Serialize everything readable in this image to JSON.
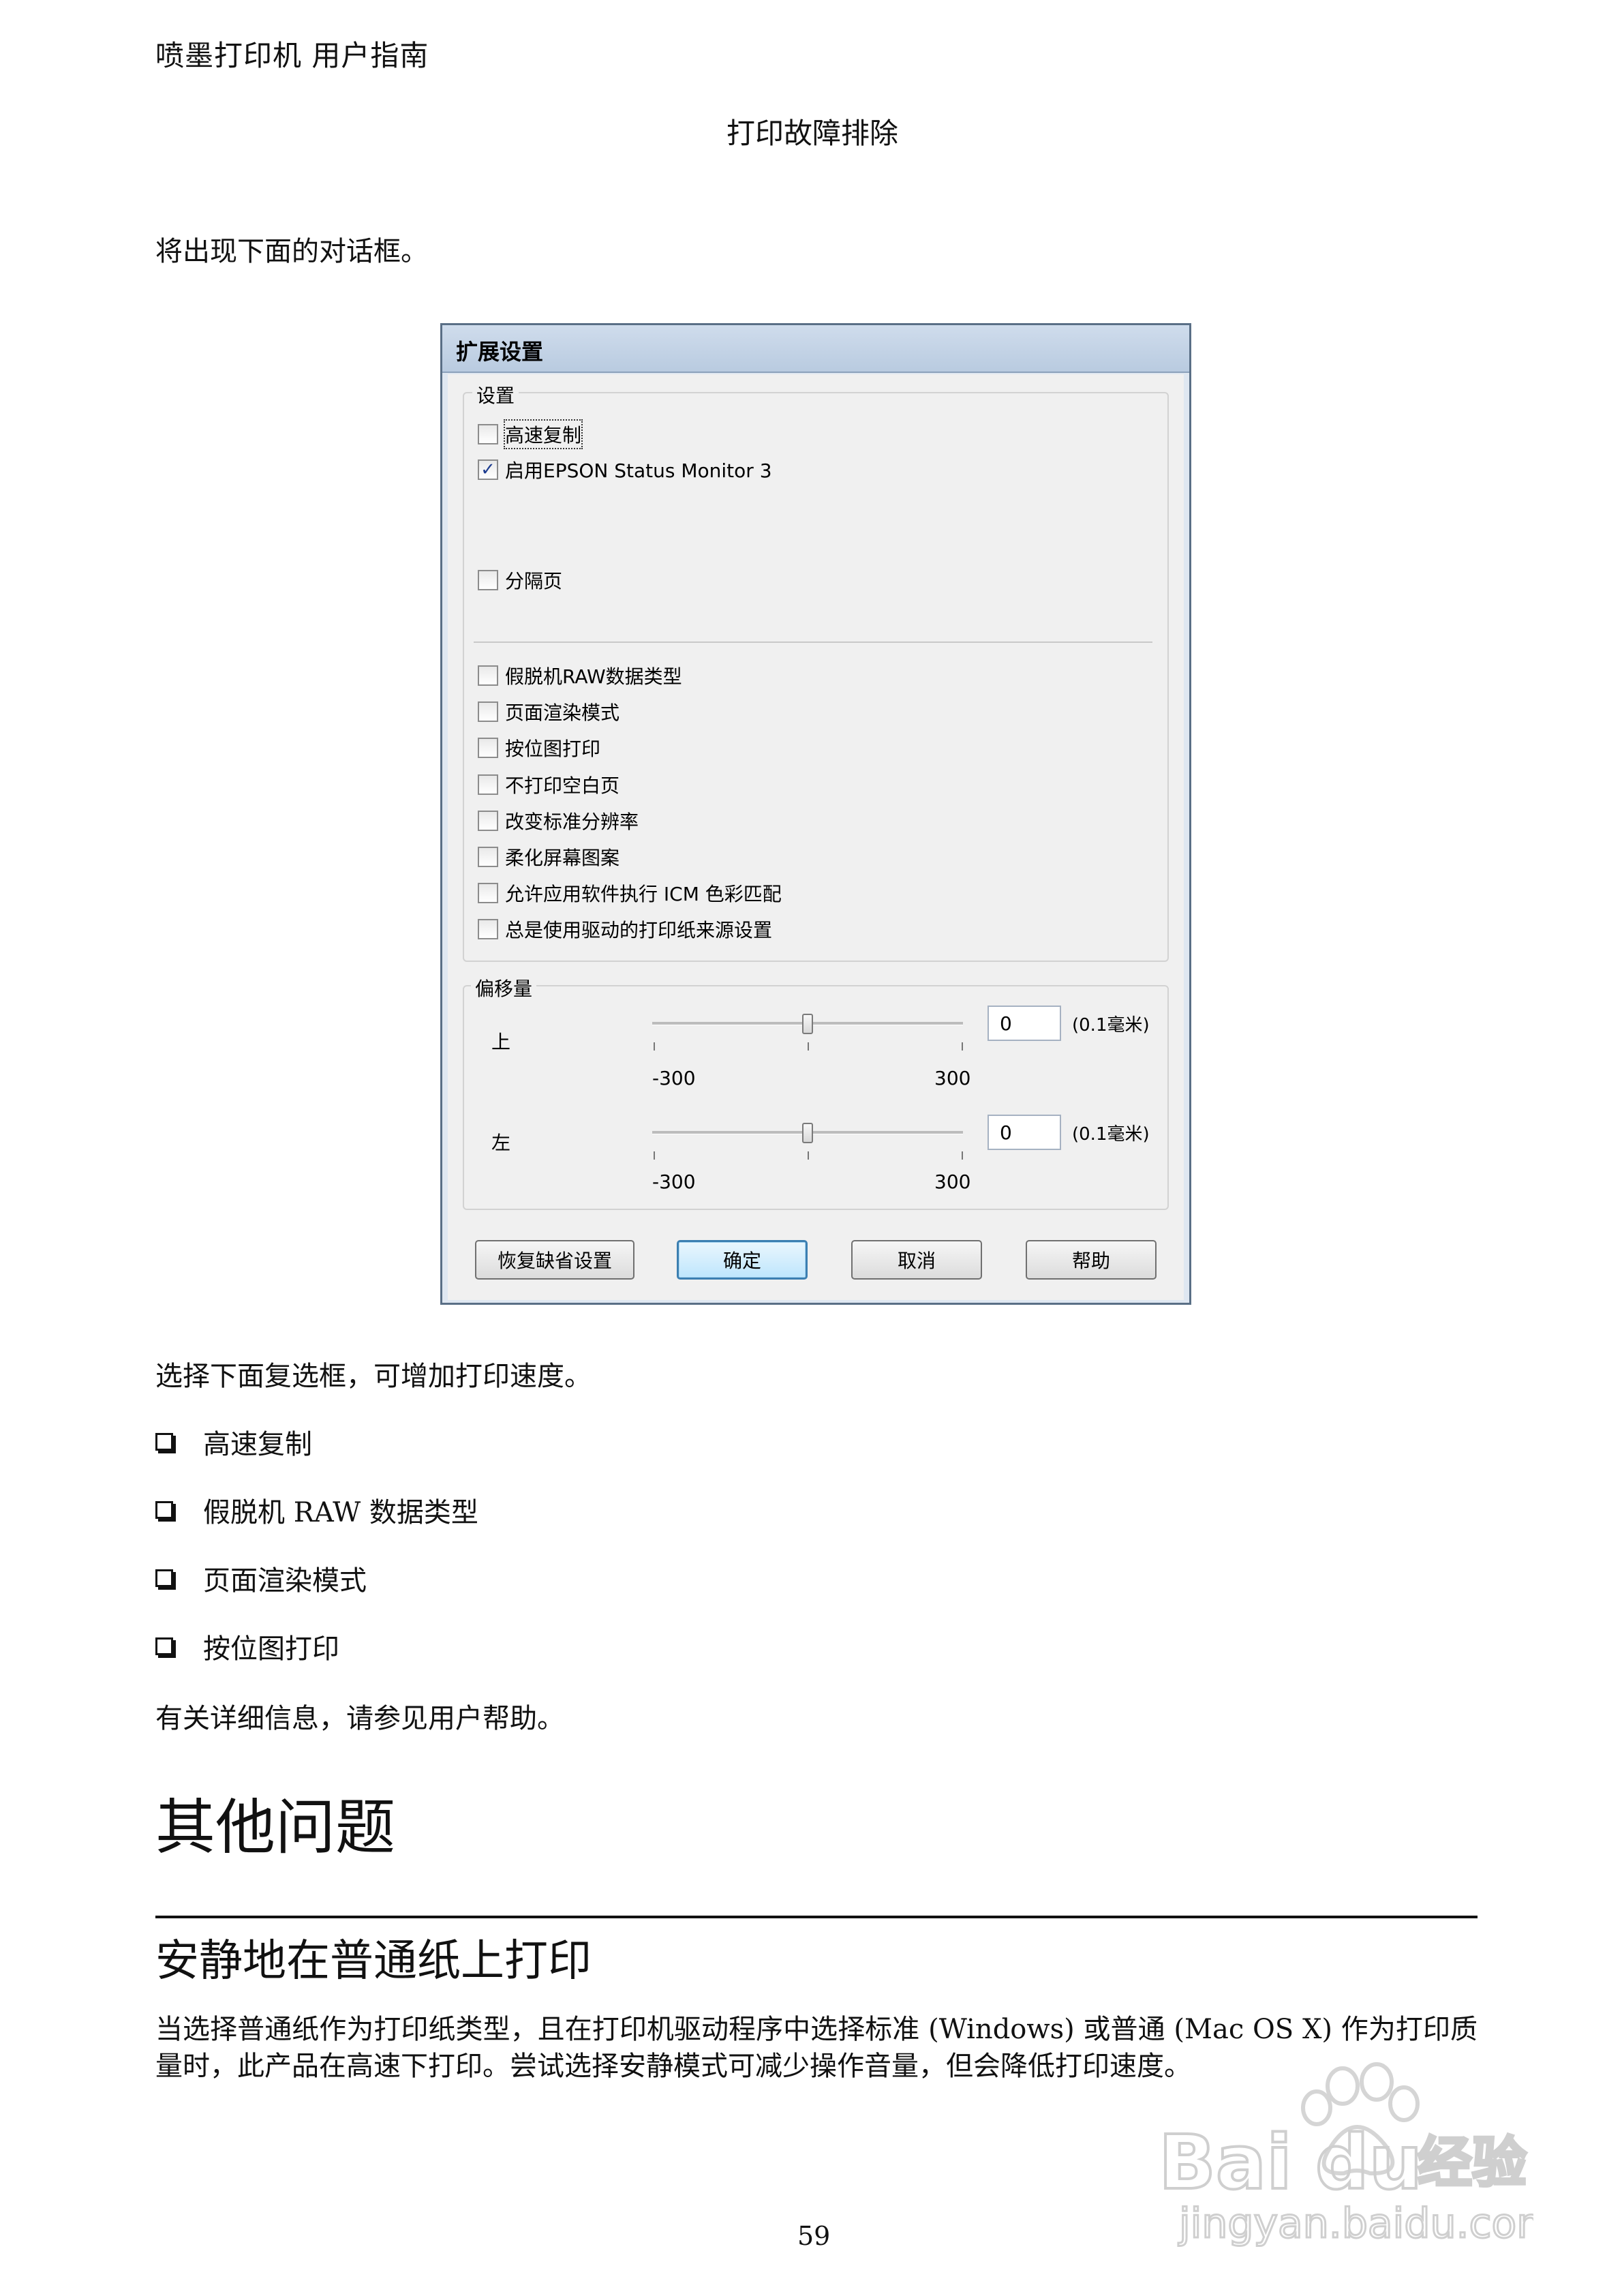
{
  "header": "喷墨打印机 用户指南",
  "section_title": "打印故障排除",
  "intro": "将出现下面的对话框。",
  "dialog": {
    "title": "扩展设置",
    "settings_group": "设置",
    "checkboxes_top": [
      {
        "label": "高速复制",
        "checked": false
      },
      {
        "label": "启用EPSON Status Monitor 3",
        "checked": true
      },
      {
        "label": "分隔页",
        "checked": false
      }
    ],
    "checkboxes_bottom": [
      {
        "label": "假脱机RAW数据类型",
        "checked": false
      },
      {
        "label": "页面渲染模式",
        "checked": false
      },
      {
        "label": "按位图打印",
        "checked": false
      },
      {
        "label": "不打印空白页",
        "checked": false
      },
      {
        "label": "改变标准分辨率",
        "checked": false
      },
      {
        "label": "柔化屏幕图案",
        "checked": false
      },
      {
        "label": "允许应用软件执行 ICM 色彩匹配",
        "checked": false
      },
      {
        "label": "总是使用驱动的打印纸来源设置",
        "checked": false
      }
    ],
    "offset_group": "偏移量",
    "sliders": [
      {
        "label": "上",
        "min": "-300",
        "max": "300",
        "value": "0",
        "unit": "(0.1毫米)",
        "level": 0.5
      },
      {
        "label": "左",
        "min": "-300",
        "max": "300",
        "value": "0",
        "unit": "(0.1毫米)",
        "level": 0.5
      }
    ],
    "buttons": {
      "restore": "恢复缺省设置",
      "ok": "确定",
      "cancel": "取消",
      "help": "帮助"
    }
  },
  "after_dialog": "选择下面复选框，可增加打印速度。",
  "bullets": [
    "高速复制",
    "假脱机 RAW 数据类型",
    "页面渲染模式",
    "按位图打印"
  ],
  "more_info": "有关详细信息，请参见用户帮助。",
  "h1": "其他问题",
  "h2": "安静地在普通纸上打印",
  "body": "当选择普通纸作为打印纸类型，且在打印机驱动程序中选择标准 (Windows) 或普通 (Mac OS X) 作为打印质量时，此产品在高速下打印。尝试选择安静模式可减少操作音量，但会降低打印速度。",
  "page_number": "59",
  "watermark": {
    "brand": "Bai",
    "brand2": "du",
    "brand_cn": "经验",
    "url": "jingyan.baidu.com"
  }
}
